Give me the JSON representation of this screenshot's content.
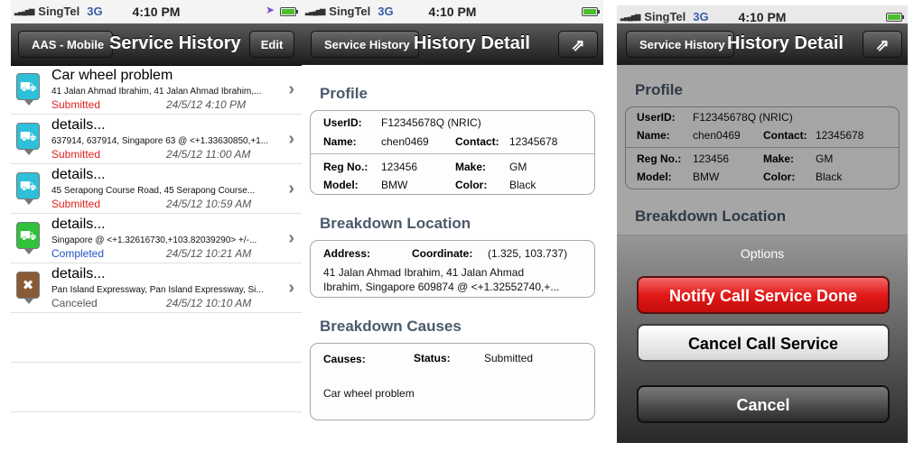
{
  "status": {
    "carrier": "SingTel",
    "network": "3G",
    "time": "4:10 PM"
  },
  "screen1": {
    "back_label": "AAS - Mobile",
    "title": "Service History",
    "edit_label": "Edit",
    "items": [
      {
        "icon": "car-icon",
        "color": "#2ec0d8",
        "title": "Car wheel problem",
        "address": "41 Jalan Ahmad Ibrahim, 41 Jalan Ahmad Ibrahim,...",
        "status": "Submitted",
        "status_color": "#e0201e",
        "date": "24/5/12 4:10 PM"
      },
      {
        "icon": "car-icon",
        "color": "#2ec0d8",
        "title": "details...",
        "address": "637914, 637914, Singapore 63 @ <+1.33630850,+1...",
        "status": "Submitted",
        "status_color": "#e0201e",
        "date": "24/5/12 11:00 AM"
      },
      {
        "icon": "car-icon",
        "color": "#2ec0d8",
        "title": "details...",
        "address": "45 Serapong Course Road, 45 Serapong Course...",
        "status": "Submitted",
        "status_color": "#e0201e",
        "date": "24/5/12 10:59 AM"
      },
      {
        "icon": "tow-truck-icon",
        "color": "#2fc23a",
        "title": "details...",
        "address": "Singapore @ <+1.32616730,+103.82039290> +/-...",
        "status": "Completed",
        "status_color": "#2152c6",
        "date": "24/5/12 10:21 AM"
      },
      {
        "icon": "cancel-icon",
        "color": "#8a5a36",
        "title": "details...",
        "address": "Pan Island Expressway, Pan Island Expressway, Si...",
        "status": "Canceled",
        "status_color": "#555555",
        "date": "24/5/12 10:10 AM"
      }
    ]
  },
  "detail": {
    "back_label": "Service History",
    "title": "History Detail",
    "profile_heading": "Profile",
    "userid_label": "UserID:",
    "userid": "F12345678Q (NRIC)",
    "name_label": "Name:",
    "name": "chen0469",
    "contact_label": "Contact:",
    "contact": "12345678",
    "reg_label": "Reg No.:",
    "reg": "123456",
    "make_label": "Make:",
    "make": "GM",
    "model_label": "Model:",
    "model": "BMW",
    "color_label": "Color:",
    "color": "Black",
    "location_heading": "Breakdown Location",
    "address_label": "Address:",
    "coordinate_label": "Coordinate:",
    "coordinate": "(1.325, 103.737)",
    "address_line1": "41 Jalan Ahmad Ibrahim, 41 Jalan Ahmad",
    "address_line2": "Ibrahim, Singapore 609874 @ <+1.32552740,+...",
    "causes_heading": "Breakdown Causes",
    "causes_label": "Causes:",
    "status_label": "Status:",
    "status": "Submitted",
    "cause": "Car wheel problem"
  },
  "options": {
    "title": "Options",
    "notify_label": "Notify Call Service Done",
    "cancel_service_label": "Cancel Call Service",
    "cancel_label": "Cancel"
  }
}
